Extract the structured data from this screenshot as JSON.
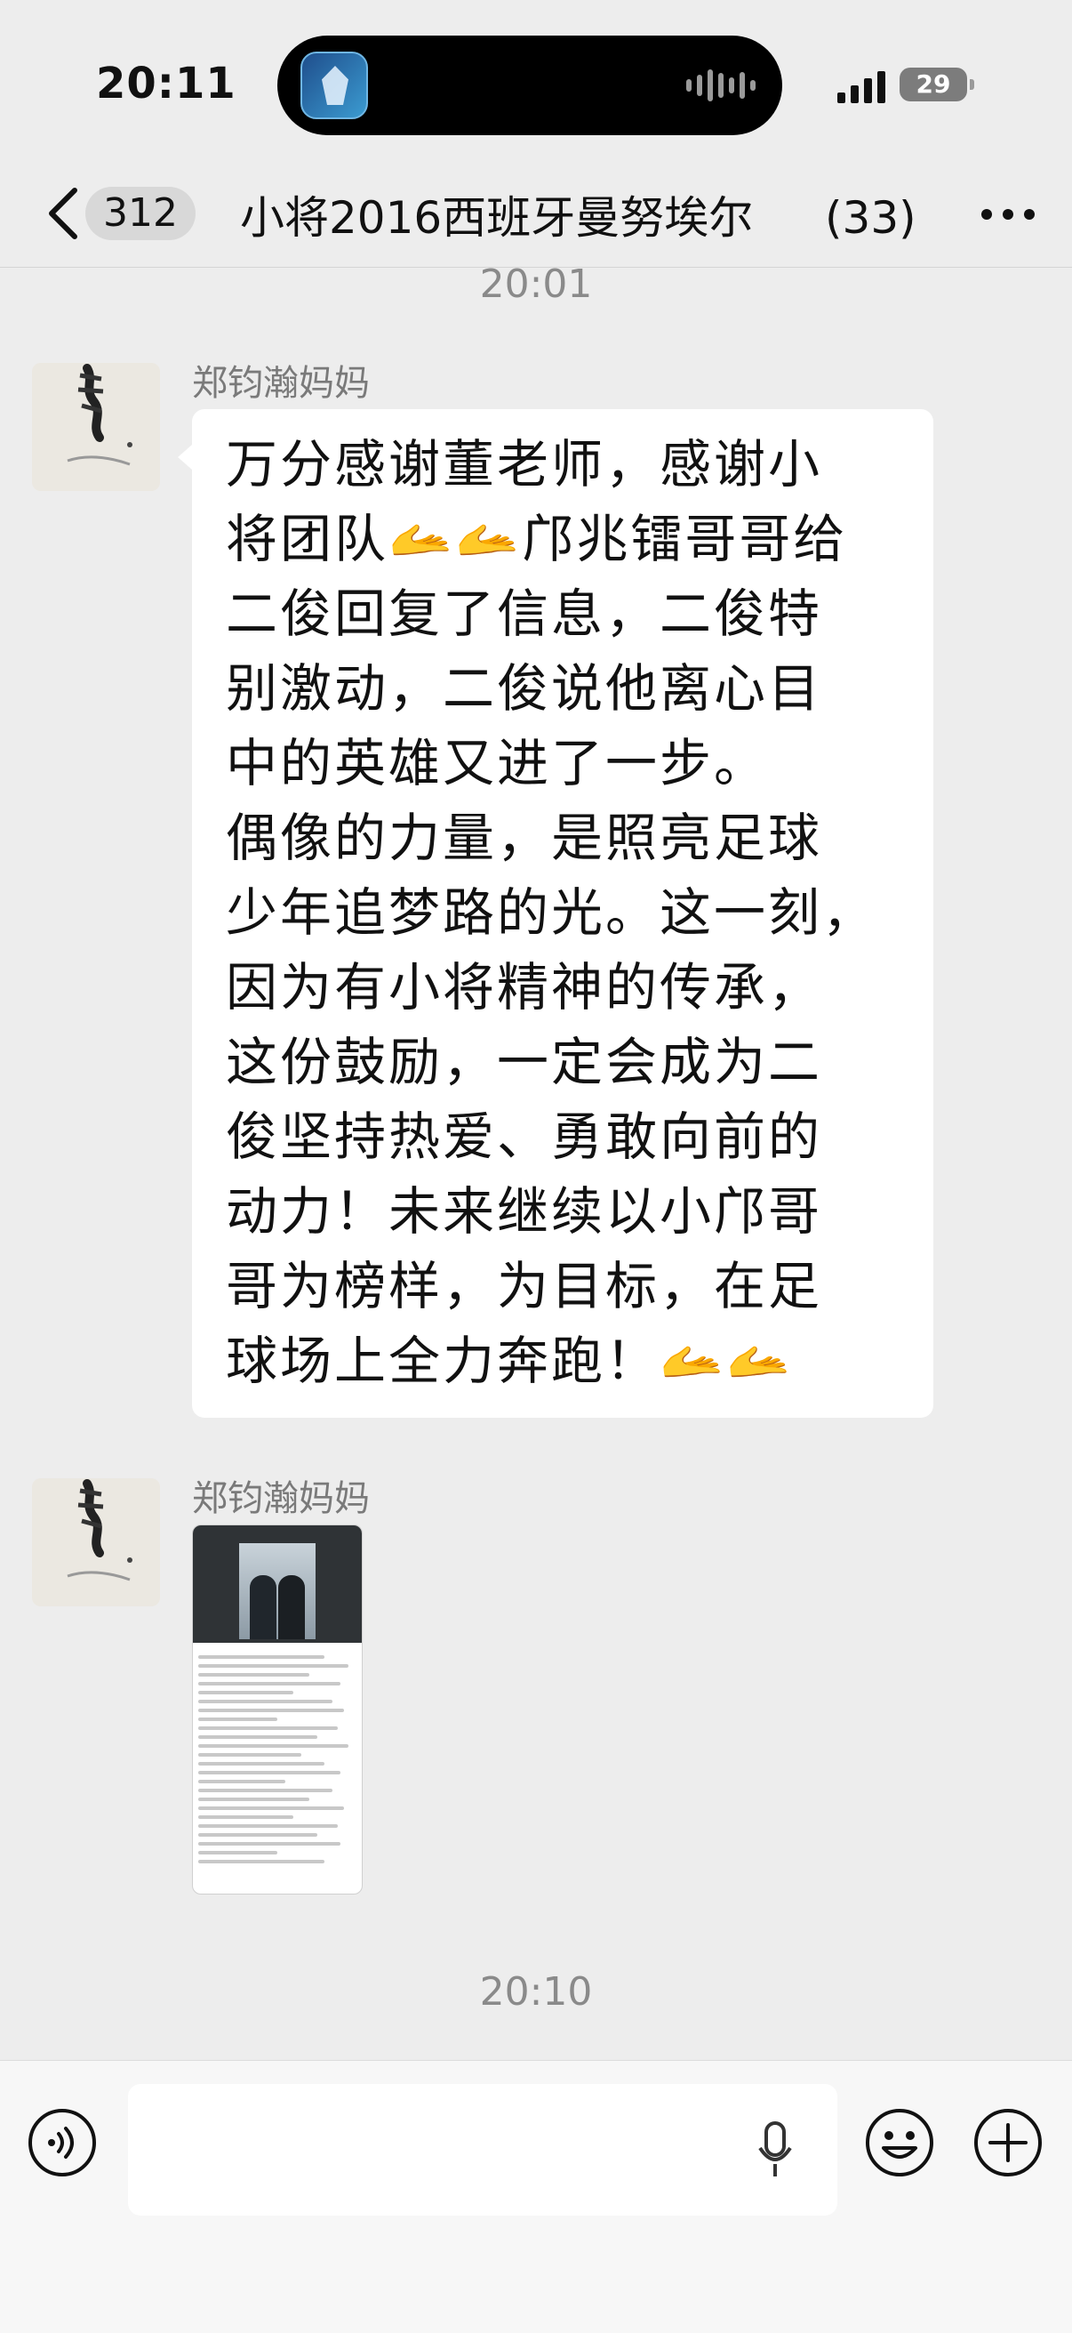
{
  "status_bar": {
    "time": "20:11",
    "battery": "29"
  },
  "nav": {
    "unread_count": "312",
    "title": "小将2016西班牙曼努埃尔",
    "member_count": "(33)"
  },
  "timestamps": [
    "20:01",
    "20:10"
  ],
  "messages": [
    {
      "sender": "郑钧瀚妈妈",
      "type": "text",
      "lines": [
        "万分感谢董老师，感谢小",
        "将团队🫴🫴邝兆镭哥哥给",
        "二俊回复了信息，二俊特",
        "别激动，二俊说他离心目",
        "中的英雄又进了一步。",
        "偶像的力量，是照亮足球",
        "少年追梦路的光。这一刻，",
        "因为有小将精神的传承，",
        "这份鼓励，一定会成为二",
        "俊坚持热爱、勇敢向前的",
        "动力！未来继续以小邝哥",
        "哥为榜样，为目标，在足",
        "球场上全力奔跑！🫴🫴"
      ]
    },
    {
      "sender": "郑钧瀚妈妈",
      "type": "image"
    }
  ],
  "icons": {
    "back": "chevron-left-icon",
    "more": "more-dots-icon",
    "voice": "voice-input-icon",
    "mic": "microphone-icon",
    "emoji": "emoji-icon",
    "plus": "plus-icon"
  }
}
